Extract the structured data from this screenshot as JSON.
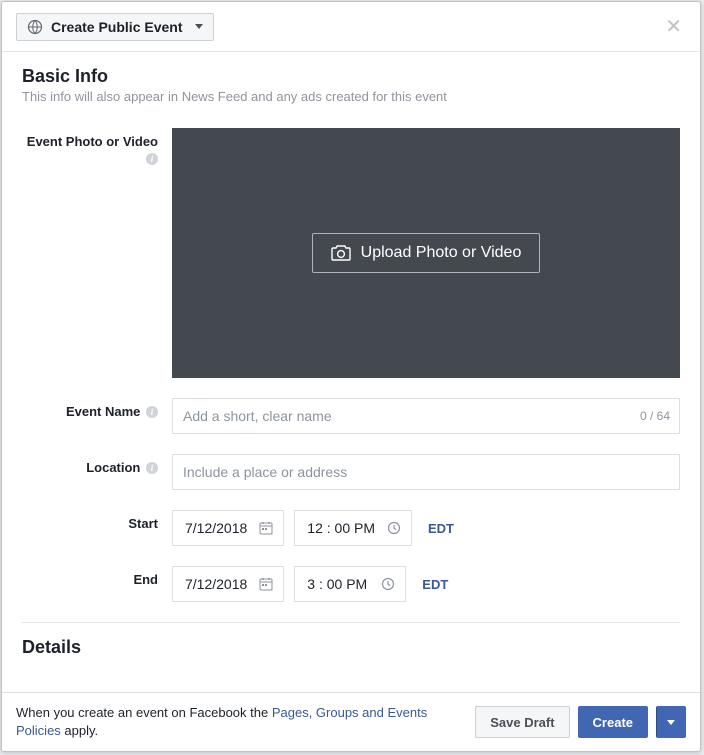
{
  "header": {
    "title": "Create Public Event"
  },
  "basic_info": {
    "title": "Basic Info",
    "subtitle": "This info will also appear in News Feed and any ads created for this event",
    "photo_label": "Event Photo or Video",
    "upload_label": "Upload Photo or Video",
    "name_label": "Event Name",
    "name_placeholder": "Add a short, clear name",
    "name_count": "0 / 64",
    "location_label": "Location",
    "location_placeholder": "Include a place or address",
    "start_label": "Start",
    "start_date": "7/12/2018",
    "start_time": "12 : 00 PM",
    "start_tz": "EDT",
    "end_label": "End",
    "end_date": "7/12/2018",
    "end_time": "3 : 00 PM",
    "end_tz": "EDT"
  },
  "details": {
    "title": "Details"
  },
  "footer": {
    "text_before": "When you create an event on Facebook the ",
    "policy_link": "Pages, Groups and Events Policies",
    "text_after": " apply.",
    "save_draft": "Save Draft",
    "create": "Create"
  }
}
